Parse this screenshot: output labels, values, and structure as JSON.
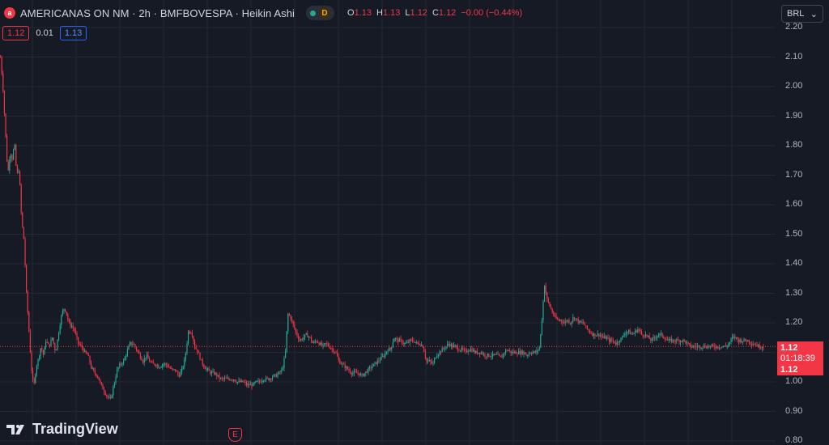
{
  "header": {
    "title": "AMERICANAS ON NM · 2h · BMFBOVESPA · Heikin Ashi",
    "logo_letter": "a",
    "badge_letter": "D",
    "ohlc": [
      {
        "k": "O",
        "v": "1.13"
      },
      {
        "k": "H",
        "v": "1.13"
      },
      {
        "k": "L",
        "v": "1.12"
      },
      {
        "k": "C",
        "v": "1.12"
      }
    ],
    "change": "−0.00 (−0.44%)"
  },
  "order": {
    "sell": "1.12",
    "spread": "0.01",
    "buy": "1.13"
  },
  "currency_button": {
    "label": "BRL",
    "chevron": "⌄"
  },
  "price_tags": {
    "last_price": "1.12",
    "countdown": "01:18:39",
    "second_price": "1.12"
  },
  "brand": {
    "name": "TradingView"
  },
  "earnings_marker": {
    "letter": "E"
  },
  "colors": {
    "background": "#161a25",
    "up": "#22ab94",
    "down": "#f23645",
    "grid": "#242832",
    "text": "#b2b5be"
  },
  "chart_data": {
    "type": "candlestick",
    "style": "Heikin Ashi",
    "interval": "2h",
    "symbol": "AMERICANAS ON NM",
    "exchange": "BMFBOVESPA",
    "currency": "BRL",
    "ylim": [
      0.8,
      2.2
    ],
    "yticks": [
      "2.20",
      "2.10",
      "2.00",
      "1.90",
      "1.80",
      "1.70",
      "1.60",
      "1.50",
      "1.40",
      "1.30",
      "1.20",
      "1.10",
      "1.00",
      "0.90",
      "0.80"
    ],
    "last_price": 1.12,
    "grid": true,
    "closes_path": [
      [
        0,
        2.1
      ],
      [
        3,
        2.0
      ],
      [
        6,
        1.85
      ],
      [
        9,
        1.7
      ],
      [
        12,
        1.78
      ],
      [
        15,
        1.75
      ],
      [
        17,
        1.82
      ],
      [
        20,
        1.7
      ],
      [
        23,
        1.72
      ],
      [
        26,
        1.55
      ],
      [
        29,
        1.48
      ],
      [
        32,
        1.3
      ],
      [
        35,
        1.18
      ],
      [
        38,
        1.05
      ],
      [
        41,
        0.98
      ],
      [
        44,
        1.05
      ],
      [
        47,
        1.08
      ],
      [
        50,
        1.12
      ],
      [
        53,
        1.09
      ],
      [
        56,
        1.14
      ],
      [
        60,
        1.12
      ],
      [
        64,
        1.15
      ],
      [
        68,
        1.1
      ],
      [
        72,
        1.17
      ],
      [
        75,
        1.22
      ],
      [
        78,
        1.25
      ],
      [
        81,
        1.24
      ],
      [
        84,
        1.2
      ],
      [
        88,
        1.19
      ],
      [
        92,
        1.17
      ],
      [
        96,
        1.13
      ],
      [
        100,
        1.12
      ],
      [
        104,
        1.1
      ],
      [
        108,
        1.09
      ],
      [
        112,
        1.05
      ],
      [
        116,
        1.03
      ],
      [
        120,
        1.02
      ],
      [
        124,
        0.99
      ],
      [
        128,
        0.97
      ],
      [
        132,
        0.95
      ],
      [
        136,
        0.94
      ],
      [
        140,
        0.99
      ],
      [
        144,
        1.04
      ],
      [
        148,
        1.06
      ],
      [
        152,
        1.07
      ],
      [
        156,
        1.1
      ],
      [
        160,
        1.13
      ],
      [
        164,
        1.13
      ],
      [
        168,
        1.11
      ],
      [
        172,
        1.09
      ],
      [
        176,
        1.07
      ],
      [
        180,
        1.09
      ],
      [
        184,
        1.07
      ],
      [
        188,
        1.06
      ],
      [
        192,
        1.06
      ],
      [
        196,
        1.05
      ],
      [
        200,
        1.06
      ],
      [
        204,
        1.06
      ],
      [
        208,
        1.05
      ],
      [
        212,
        1.04
      ],
      [
        216,
        1.04
      ],
      [
        220,
        1.02
      ],
      [
        224,
        1.04
      ],
      [
        228,
        1.08
      ],
      [
        232,
        1.17
      ],
      [
        236,
        1.17
      ],
      [
        240,
        1.12
      ],
      [
        244,
        1.1
      ],
      [
        248,
        1.07
      ],
      [
        252,
        1.05
      ],
      [
        256,
        1.04
      ],
      [
        260,
        1.03
      ],
      [
        264,
        1.03
      ],
      [
        268,
        1.02
      ],
      [
        272,
        1.01
      ],
      [
        276,
        1.01
      ],
      [
        280,
        1.01
      ],
      [
        284,
        1.01
      ],
      [
        288,
        1.01
      ],
      [
        292,
        1.0
      ],
      [
        296,
        1.0
      ],
      [
        300,
        1.0
      ],
      [
        304,
        0.99
      ],
      [
        308,
        0.99
      ],
      [
        312,
        0.99
      ],
      [
        316,
        1.0
      ],
      [
        320,
        1.0
      ],
      [
        324,
        1.01
      ],
      [
        328,
        1.01
      ],
      [
        332,
        1.01
      ],
      [
        336,
        1.02
      ],
      [
        340,
        1.02
      ],
      [
        344,
        1.03
      ],
      [
        348,
        1.04
      ],
      [
        352,
        1.1
      ],
      [
        355,
        1.23
      ],
      [
        358,
        1.22
      ],
      [
        362,
        1.19
      ],
      [
        366,
        1.16
      ],
      [
        370,
        1.14
      ],
      [
        374,
        1.15
      ],
      [
        378,
        1.16
      ],
      [
        382,
        1.15
      ],
      [
        386,
        1.13
      ],
      [
        390,
        1.14
      ],
      [
        394,
        1.13
      ],
      [
        398,
        1.12
      ],
      [
        402,
        1.13
      ],
      [
        406,
        1.12
      ],
      [
        410,
        1.11
      ],
      [
        414,
        1.1
      ],
      [
        418,
        1.07
      ],
      [
        422,
        1.06
      ],
      [
        426,
        1.05
      ],
      [
        430,
        1.04
      ],
      [
        434,
        1.03
      ],
      [
        438,
        1.03
      ],
      [
        442,
        1.03
      ],
      [
        446,
        1.02
      ],
      [
        450,
        1.03
      ],
      [
        454,
        1.04
      ],
      [
        458,
        1.05
      ],
      [
        462,
        1.06
      ],
      [
        466,
        1.07
      ],
      [
        470,
        1.08
      ],
      [
        474,
        1.09
      ],
      [
        478,
        1.11
      ],
      [
        482,
        1.11
      ],
      [
        486,
        1.15
      ],
      [
        490,
        1.14
      ],
      [
        494,
        1.14
      ],
      [
        498,
        1.13
      ],
      [
        502,
        1.13
      ],
      [
        506,
        1.14
      ],
      [
        510,
        1.14
      ],
      [
        514,
        1.13
      ],
      [
        518,
        1.13
      ],
      [
        522,
        1.12
      ],
      [
        526,
        1.07
      ],
      [
        530,
        1.07
      ],
      [
        534,
        1.06
      ],
      [
        538,
        1.09
      ],
      [
        542,
        1.1
      ],
      [
        546,
        1.11
      ],
      [
        550,
        1.12
      ],
      [
        554,
        1.13
      ],
      [
        558,
        1.12
      ],
      [
        562,
        1.12
      ],
      [
        566,
        1.11
      ],
      [
        570,
        1.11
      ],
      [
        574,
        1.1
      ],
      [
        578,
        1.11
      ],
      [
        582,
        1.11
      ],
      [
        586,
        1.1
      ],
      [
        590,
        1.1
      ],
      [
        594,
        1.1
      ],
      [
        598,
        1.09
      ],
      [
        602,
        1.09
      ],
      [
        606,
        1.09
      ],
      [
        610,
        1.09
      ],
      [
        614,
        1.09
      ],
      [
        618,
        1.08
      ],
      [
        622,
        1.1
      ],
      [
        626,
        1.11
      ],
      [
        630,
        1.1
      ],
      [
        634,
        1.1
      ],
      [
        638,
        1.1
      ],
      [
        642,
        1.1
      ],
      [
        646,
        1.1
      ],
      [
        650,
        1.09
      ],
      [
        654,
        1.1
      ],
      [
        658,
        1.1
      ],
      [
        662,
        1.1
      ],
      [
        666,
        1.12
      ],
      [
        669,
        1.22
      ],
      [
        672,
        1.33
      ],
      [
        675,
        1.28
      ],
      [
        678,
        1.26
      ],
      [
        681,
        1.24
      ],
      [
        684,
        1.22
      ],
      [
        688,
        1.21
      ],
      [
        692,
        1.21
      ],
      [
        696,
        1.2
      ],
      [
        700,
        1.21
      ],
      [
        704,
        1.2
      ],
      [
        708,
        1.22
      ],
      [
        712,
        1.21
      ],
      [
        716,
        1.2
      ],
      [
        720,
        1.2
      ],
      [
        724,
        1.18
      ],
      [
        728,
        1.17
      ],
      [
        732,
        1.16
      ],
      [
        736,
        1.16
      ],
      [
        740,
        1.16
      ],
      [
        744,
        1.15
      ],
      [
        748,
        1.15
      ],
      [
        752,
        1.14
      ],
      [
        756,
        1.14
      ],
      [
        760,
        1.13
      ],
      [
        764,
        1.14
      ],
      [
        768,
        1.15
      ],
      [
        772,
        1.17
      ],
      [
        776,
        1.17
      ],
      [
        780,
        1.16
      ],
      [
        784,
        1.17
      ],
      [
        788,
        1.18
      ],
      [
        792,
        1.16
      ],
      [
        796,
        1.16
      ],
      [
        800,
        1.15
      ],
      [
        804,
        1.14
      ],
      [
        808,
        1.15
      ],
      [
        812,
        1.16
      ],
      [
        816,
        1.16
      ],
      [
        820,
        1.15
      ],
      [
        824,
        1.14
      ],
      [
        828,
        1.14
      ],
      [
        832,
        1.14
      ],
      [
        836,
        1.14
      ],
      [
        840,
        1.14
      ],
      [
        844,
        1.14
      ],
      [
        848,
        1.13
      ],
      [
        852,
        1.12
      ],
      [
        856,
        1.12
      ],
      [
        860,
        1.12
      ],
      [
        864,
        1.12
      ],
      [
        868,
        1.12
      ],
      [
        872,
        1.12
      ],
      [
        876,
        1.12
      ],
      [
        880,
        1.12
      ],
      [
        884,
        1.12
      ],
      [
        888,
        1.12
      ],
      [
        892,
        1.12
      ],
      [
        896,
        1.12
      ],
      [
        900,
        1.13
      ],
      [
        904,
        1.15
      ],
      [
        908,
        1.15
      ],
      [
        912,
        1.14
      ],
      [
        916,
        1.14
      ],
      [
        920,
        1.14
      ],
      [
        924,
        1.14
      ],
      [
        928,
        1.13
      ],
      [
        932,
        1.13
      ],
      [
        936,
        1.12
      ],
      [
        940,
        1.12
      ],
      [
        944,
        1.12
      ]
    ]
  }
}
